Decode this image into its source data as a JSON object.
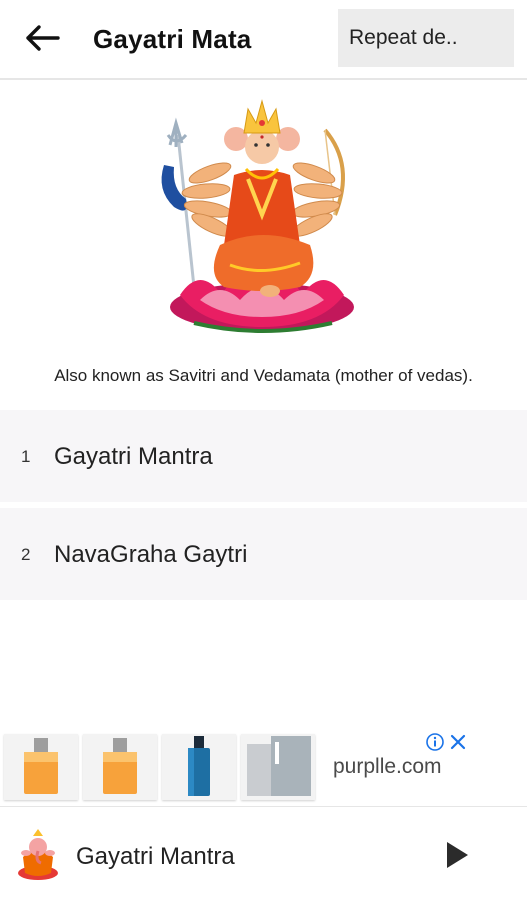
{
  "header": {
    "back_icon": "arrow-left-icon",
    "title": "Gayatri Mata",
    "repeat_label": "Repeat de.."
  },
  "deity": {
    "image": "gayatri-mata-illustration",
    "description": "Also known as Savitri and Vedamata (mother of vedas)."
  },
  "list": {
    "items": [
      {
        "number": "1",
        "label": "Gayatri Mantra"
      },
      {
        "number": "2",
        "label": "NavaGraha Gaytri"
      }
    ]
  },
  "ad": {
    "brand": "purplle.com",
    "info_icon": "info-icon",
    "close_icon": "close-icon",
    "products": [
      "perfume-bottle-1",
      "perfume-bottle-2",
      "cologne-bottle",
      "echo-perfume-box"
    ],
    "accent_color": "#1a73e8"
  },
  "player": {
    "thumb_icon": "ganesha-icon",
    "now_playing": "Gayatri Mantra",
    "play_icon": "play-icon"
  }
}
